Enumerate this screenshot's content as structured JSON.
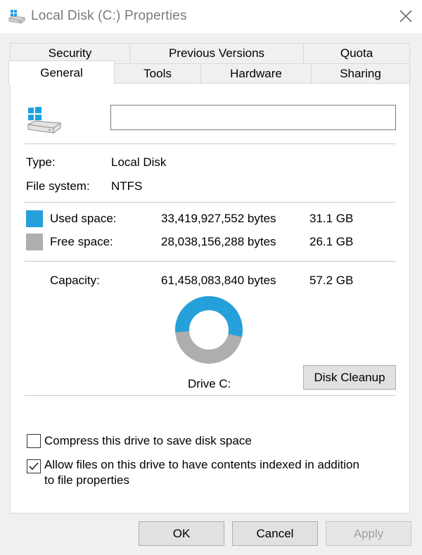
{
  "window": {
    "title": "Local Disk (C:) Properties"
  },
  "tabs": {
    "row1": [
      {
        "label": "Security"
      },
      {
        "label": "Previous Versions"
      },
      {
        "label": "Quota"
      }
    ],
    "row2": [
      {
        "label": "General",
        "active": true
      },
      {
        "label": "Tools"
      },
      {
        "label": "Hardware"
      },
      {
        "label": "Sharing"
      }
    ]
  },
  "general": {
    "name_value": "",
    "type_label": "Type:",
    "type_value": "Local Disk",
    "fs_label": "File system:",
    "fs_value": "NTFS",
    "used": {
      "label": "Used space:",
      "bytes": "33,419,927,552 bytes",
      "size": "31.1 GB",
      "color": "#26a0da"
    },
    "free": {
      "label": "Free space:",
      "bytes": "28,038,156,288 bytes",
      "size": "26.1 GB",
      "color": "#aeaeae"
    },
    "capacity": {
      "label": "Capacity:",
      "bytes": "61,458,083,840 bytes",
      "size": "57.2 GB"
    },
    "used_fraction": 0.5438,
    "drive_label": "Drive C:",
    "cleanup_button": "Disk Cleanup",
    "compress_label": "Compress this drive to save disk space",
    "compress_checked": false,
    "index_label_line1": "Allow files on this drive to have contents indexed in addition",
    "index_label_line2": "to file properties",
    "index_checked": true
  },
  "buttons": {
    "ok": "OK",
    "cancel": "Cancel",
    "apply": "Apply"
  }
}
